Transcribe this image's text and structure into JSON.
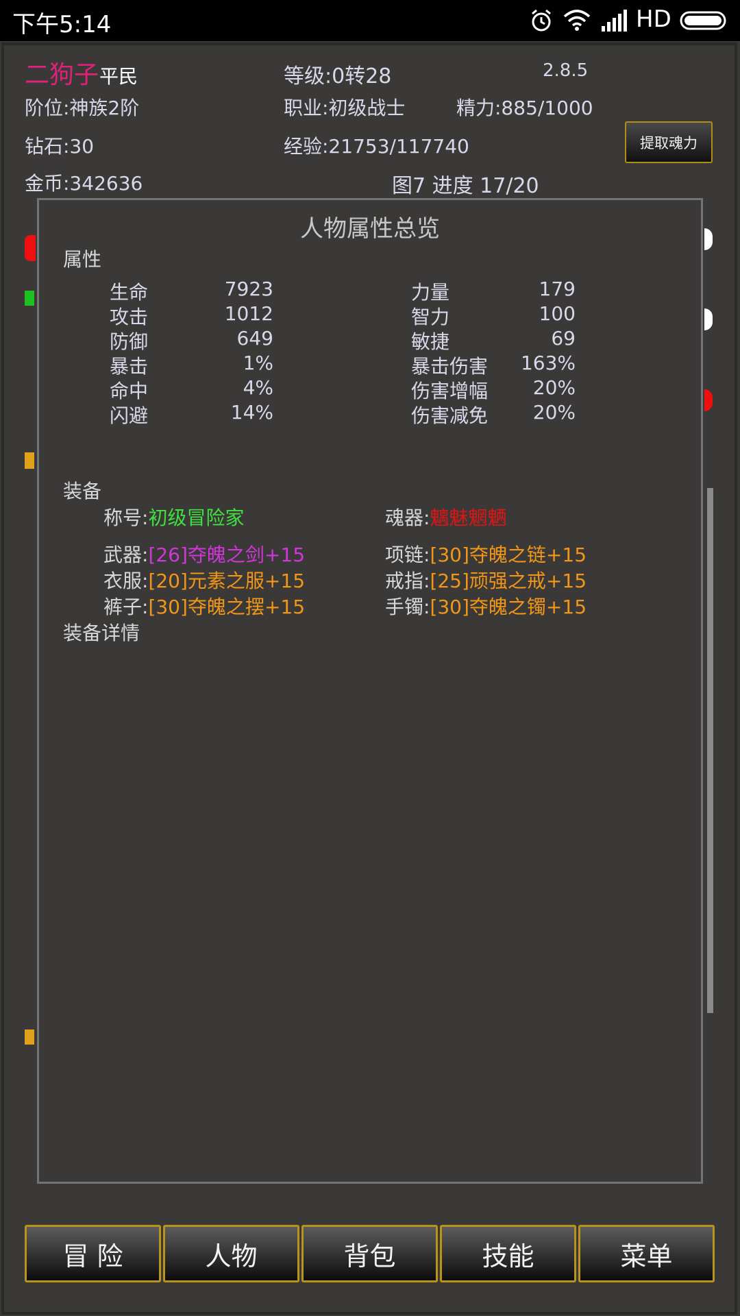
{
  "status_bar": {
    "time": "下午5:14",
    "network": "HD"
  },
  "player": {
    "name": "二狗子",
    "rank_title": "平民",
    "level": "等级:0转28",
    "version": "2.8.5",
    "tier": "阶位:神族2阶",
    "job": "职业:初级战士",
    "energy": "精力:885/1000",
    "diamond": "钻石:30",
    "exp": "经验:21753/117740",
    "gold": "金币:342636",
    "map_progress": "图7  进度 17/20",
    "extract_soul_button": "提取魂力"
  },
  "modal": {
    "title": "人物属性总览",
    "attr_section": "属性",
    "attributes_left": [
      {
        "label": "生命",
        "value": "7923"
      },
      {
        "label": "攻击",
        "value": "1012"
      },
      {
        "label": "防御",
        "value": "649"
      },
      {
        "label": "暴击",
        "value": "1%"
      },
      {
        "label": "命中",
        "value": "4%"
      },
      {
        "label": "闪避",
        "value": "14%"
      }
    ],
    "attributes_right": [
      {
        "label": "力量",
        "value": "179"
      },
      {
        "label": "智力",
        "value": "100"
      },
      {
        "label": "敏捷",
        "value": "69"
      },
      {
        "label": "暴击伤害",
        "value": "163%"
      },
      {
        "label": "伤害增幅",
        "value": "20%"
      },
      {
        "label": "伤害减免",
        "value": "20%"
      }
    ],
    "equip_section": "装备",
    "title_label": "称号:",
    "title_value": "初级冒险家",
    "soul_label": "魂器:",
    "soul_value": "魑魅魍魉",
    "weapon_label": "武器:",
    "weapon_value": "[26]夺魄之剑+15",
    "necklace_label": "项链:",
    "necklace_value": "[30]夺魄之链+15",
    "clothes_label": "衣服:",
    "clothes_value": "[20]元素之服+15",
    "ring_label": "戒指:",
    "ring_value": "[25]顽强之戒+15",
    "pants_label": "裤子:",
    "pants_value": "[30]夺魄之摆+15",
    "bracelet_label": "手镯:",
    "bracelet_value": "[30]夺魄之镯+15",
    "equip_detail": "装备详情"
  },
  "nav": [
    "冒 险",
    "人物",
    "背包",
    "技能",
    "菜单"
  ],
  "colors": {
    "name": "#e0207a",
    "title_green": "#3fe03f",
    "soul_red": "#e01414",
    "weapon_purple": "#d036d8",
    "gear_orange": "#f29618",
    "button_border": "#b8951a"
  }
}
